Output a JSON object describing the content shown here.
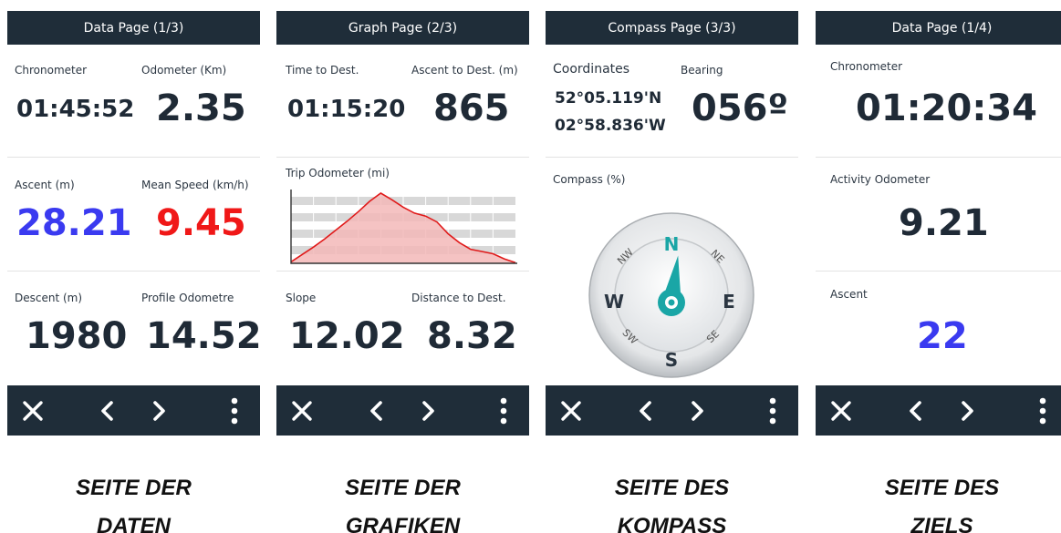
{
  "screens": [
    {
      "title": "Data Page (1/3)",
      "fields": [
        {
          "label": "Chronometer",
          "value": "01:45:52"
        },
        {
          "label": "Odometer (Km)",
          "value": "2.35"
        },
        {
          "label": "Ascent (m)",
          "value": "28.21",
          "color": "#3a3af0"
        },
        {
          "label": "Mean Speed (km/h)",
          "value": "9.45",
          "color": "#f01818"
        },
        {
          "label": "Descent (m)",
          "value": "1980"
        },
        {
          "label": "Profile Odometre",
          "value": "14.52"
        }
      ],
      "caption": [
        "SEITE DER",
        "DATEN"
      ]
    },
    {
      "title": "Graph Page (2/3)",
      "fields": [
        {
          "label": "Time to Dest.",
          "value": "01:15:20"
        },
        {
          "label": "Ascent to Dest. (m)",
          "value": "865"
        },
        {
          "label": "Slope",
          "value": "12.02"
        },
        {
          "label": "Distance to Dest.",
          "value": "8.32"
        }
      ],
      "graph_label": "Trip Odometer (mi)",
      "caption": [
        "SEITE DER",
        "GRAFIKEN"
      ]
    },
    {
      "title": "Compass Page (3/3)",
      "coordinates_label": "Coordinates",
      "coordinates": [
        "52°05.119'N",
        "02°58.836'W"
      ],
      "bearing_label": "Bearing",
      "bearing_value": "056º",
      "compass_label": "Compass (%)",
      "compass": {
        "n": "N",
        "e": "E",
        "s": "S",
        "w": "W",
        "ne": "NE",
        "nw": "NW",
        "se": "SE",
        "sw": "SW"
      },
      "caption": [
        "SEITE DES",
        "KOMPASS"
      ]
    },
    {
      "title": "Data Page (1/4)",
      "fields": [
        {
          "label": "Chronometer",
          "value": "01:20:34"
        },
        {
          "label": "Activity Odometer",
          "value": "9.21"
        },
        {
          "label": "Ascent",
          "value": "22",
          "color": "#3a3af0"
        }
      ],
      "caption": [
        "SEITE DES",
        "ZIELS"
      ]
    }
  ],
  "colors": {
    "header": "#1f2d39",
    "accent_teal": "#1aa6a6",
    "graph_fill": "#f3b8b8",
    "graph_line": "#e01a1a"
  },
  "icons": [
    "close-icon",
    "chevron-left-icon",
    "chevron-right-icon",
    "more-vertical-icon"
  ],
  "chart_data": {
    "type": "area",
    "title": "Trip Odometer (mi)",
    "grid": true,
    "x": [
      0,
      1,
      2,
      3,
      4,
      5,
      6,
      7,
      8,
      9,
      10,
      11,
      12,
      13,
      14,
      15,
      16,
      17,
      18,
      19,
      20
    ],
    "y": [
      2,
      12,
      22,
      33,
      45,
      57,
      70,
      84,
      95,
      86,
      76,
      68,
      64,
      56,
      40,
      28,
      19,
      16,
      13,
      6,
      1
    ],
    "ylim": [
      0,
      100
    ]
  }
}
